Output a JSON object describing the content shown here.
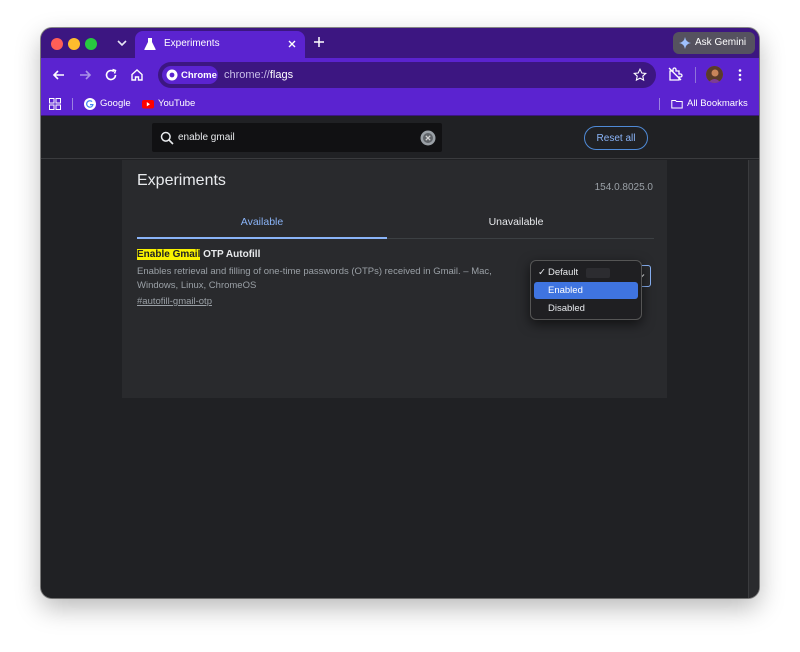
{
  "tab": {
    "title": "Experiments"
  },
  "gemini": {
    "label": "Ask Gemini"
  },
  "omnibox": {
    "chip_label": "Chrome",
    "url_prefix": "chrome://",
    "url_path": "flags"
  },
  "bookmarks": {
    "items": [
      {
        "label": "Google"
      },
      {
        "label": "YouTube"
      }
    ],
    "all_label": "All Bookmarks"
  },
  "flags": {
    "search_value": "enable gmail",
    "reset_label": "Reset all",
    "title": "Experiments",
    "version": "154.0.8025.0",
    "tabs": [
      {
        "label": "Available"
      },
      {
        "label": "Unavailable"
      }
    ],
    "flag": {
      "name_highlight": "Enable Gmail",
      "name_rest": " OTP Autofill",
      "description": "Enables retrieval and filling of one-time passwords (OTPs) received in Gmail. – Mac, Windows, Linux, ChromeOS",
      "link": "#autofill-gmail-otp"
    },
    "dropdown": {
      "check": "✓",
      "options": [
        {
          "label": "Default"
        },
        {
          "label": "Enabled"
        },
        {
          "label": "Disabled"
        }
      ],
      "highlighted": "Enabled"
    }
  },
  "colors": {
    "toolbar": "#5b23d0",
    "tabstrip": "#3c1681",
    "accent": "#8ab4f8",
    "highlight": "#f9f200"
  }
}
